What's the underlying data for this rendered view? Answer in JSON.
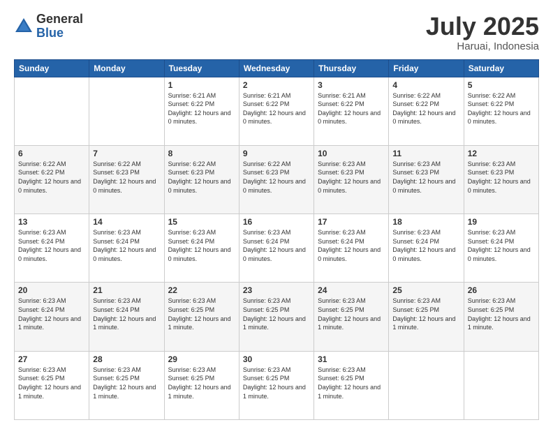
{
  "header": {
    "logo_general": "General",
    "logo_blue": "Blue",
    "month": "July 2025",
    "location": "Haruai, Indonesia"
  },
  "days_of_week": [
    "Sunday",
    "Monday",
    "Tuesday",
    "Wednesday",
    "Thursday",
    "Friday",
    "Saturday"
  ],
  "weeks": [
    [
      {
        "day": "",
        "info": ""
      },
      {
        "day": "",
        "info": ""
      },
      {
        "day": "1",
        "info": "Sunrise: 6:21 AM\nSunset: 6:22 PM\nDaylight: 12 hours\nand 0 minutes."
      },
      {
        "day": "2",
        "info": "Sunrise: 6:21 AM\nSunset: 6:22 PM\nDaylight: 12 hours\nand 0 minutes."
      },
      {
        "day": "3",
        "info": "Sunrise: 6:21 AM\nSunset: 6:22 PM\nDaylight: 12 hours\nand 0 minutes."
      },
      {
        "day": "4",
        "info": "Sunrise: 6:22 AM\nSunset: 6:22 PM\nDaylight: 12 hours\nand 0 minutes."
      },
      {
        "day": "5",
        "info": "Sunrise: 6:22 AM\nSunset: 6:22 PM\nDaylight: 12 hours\nand 0 minutes."
      }
    ],
    [
      {
        "day": "6",
        "info": "Sunrise: 6:22 AM\nSunset: 6:22 PM\nDaylight: 12 hours\nand 0 minutes."
      },
      {
        "day": "7",
        "info": "Sunrise: 6:22 AM\nSunset: 6:23 PM\nDaylight: 12 hours\nand 0 minutes."
      },
      {
        "day": "8",
        "info": "Sunrise: 6:22 AM\nSunset: 6:23 PM\nDaylight: 12 hours\nand 0 minutes."
      },
      {
        "day": "9",
        "info": "Sunrise: 6:22 AM\nSunset: 6:23 PM\nDaylight: 12 hours\nand 0 minutes."
      },
      {
        "day": "10",
        "info": "Sunrise: 6:23 AM\nSunset: 6:23 PM\nDaylight: 12 hours\nand 0 minutes."
      },
      {
        "day": "11",
        "info": "Sunrise: 6:23 AM\nSunset: 6:23 PM\nDaylight: 12 hours\nand 0 minutes."
      },
      {
        "day": "12",
        "info": "Sunrise: 6:23 AM\nSunset: 6:23 PM\nDaylight: 12 hours\nand 0 minutes."
      }
    ],
    [
      {
        "day": "13",
        "info": "Sunrise: 6:23 AM\nSunset: 6:24 PM\nDaylight: 12 hours\nand 0 minutes."
      },
      {
        "day": "14",
        "info": "Sunrise: 6:23 AM\nSunset: 6:24 PM\nDaylight: 12 hours\nand 0 minutes."
      },
      {
        "day": "15",
        "info": "Sunrise: 6:23 AM\nSunset: 6:24 PM\nDaylight: 12 hours\nand 0 minutes."
      },
      {
        "day": "16",
        "info": "Sunrise: 6:23 AM\nSunset: 6:24 PM\nDaylight: 12 hours\nand 0 minutes."
      },
      {
        "day": "17",
        "info": "Sunrise: 6:23 AM\nSunset: 6:24 PM\nDaylight: 12 hours\nand 0 minutes."
      },
      {
        "day": "18",
        "info": "Sunrise: 6:23 AM\nSunset: 6:24 PM\nDaylight: 12 hours\nand 0 minutes."
      },
      {
        "day": "19",
        "info": "Sunrise: 6:23 AM\nSunset: 6:24 PM\nDaylight: 12 hours\nand 0 minutes."
      }
    ],
    [
      {
        "day": "20",
        "info": "Sunrise: 6:23 AM\nSunset: 6:24 PM\nDaylight: 12 hours\nand 1 minute."
      },
      {
        "day": "21",
        "info": "Sunrise: 6:23 AM\nSunset: 6:24 PM\nDaylight: 12 hours\nand 1 minute."
      },
      {
        "day": "22",
        "info": "Sunrise: 6:23 AM\nSunset: 6:25 PM\nDaylight: 12 hours\nand 1 minute."
      },
      {
        "day": "23",
        "info": "Sunrise: 6:23 AM\nSunset: 6:25 PM\nDaylight: 12 hours\nand 1 minute."
      },
      {
        "day": "24",
        "info": "Sunrise: 6:23 AM\nSunset: 6:25 PM\nDaylight: 12 hours\nand 1 minute."
      },
      {
        "day": "25",
        "info": "Sunrise: 6:23 AM\nSunset: 6:25 PM\nDaylight: 12 hours\nand 1 minute."
      },
      {
        "day": "26",
        "info": "Sunrise: 6:23 AM\nSunset: 6:25 PM\nDaylight: 12 hours\nand 1 minute."
      }
    ],
    [
      {
        "day": "27",
        "info": "Sunrise: 6:23 AM\nSunset: 6:25 PM\nDaylight: 12 hours\nand 1 minute."
      },
      {
        "day": "28",
        "info": "Sunrise: 6:23 AM\nSunset: 6:25 PM\nDaylight: 12 hours\nand 1 minute."
      },
      {
        "day": "29",
        "info": "Sunrise: 6:23 AM\nSunset: 6:25 PM\nDaylight: 12 hours\nand 1 minute."
      },
      {
        "day": "30",
        "info": "Sunrise: 6:23 AM\nSunset: 6:25 PM\nDaylight: 12 hours\nand 1 minute."
      },
      {
        "day": "31",
        "info": "Sunrise: 6:23 AM\nSunset: 6:25 PM\nDaylight: 12 hours\nand 1 minute."
      },
      {
        "day": "",
        "info": ""
      },
      {
        "day": "",
        "info": ""
      }
    ]
  ]
}
